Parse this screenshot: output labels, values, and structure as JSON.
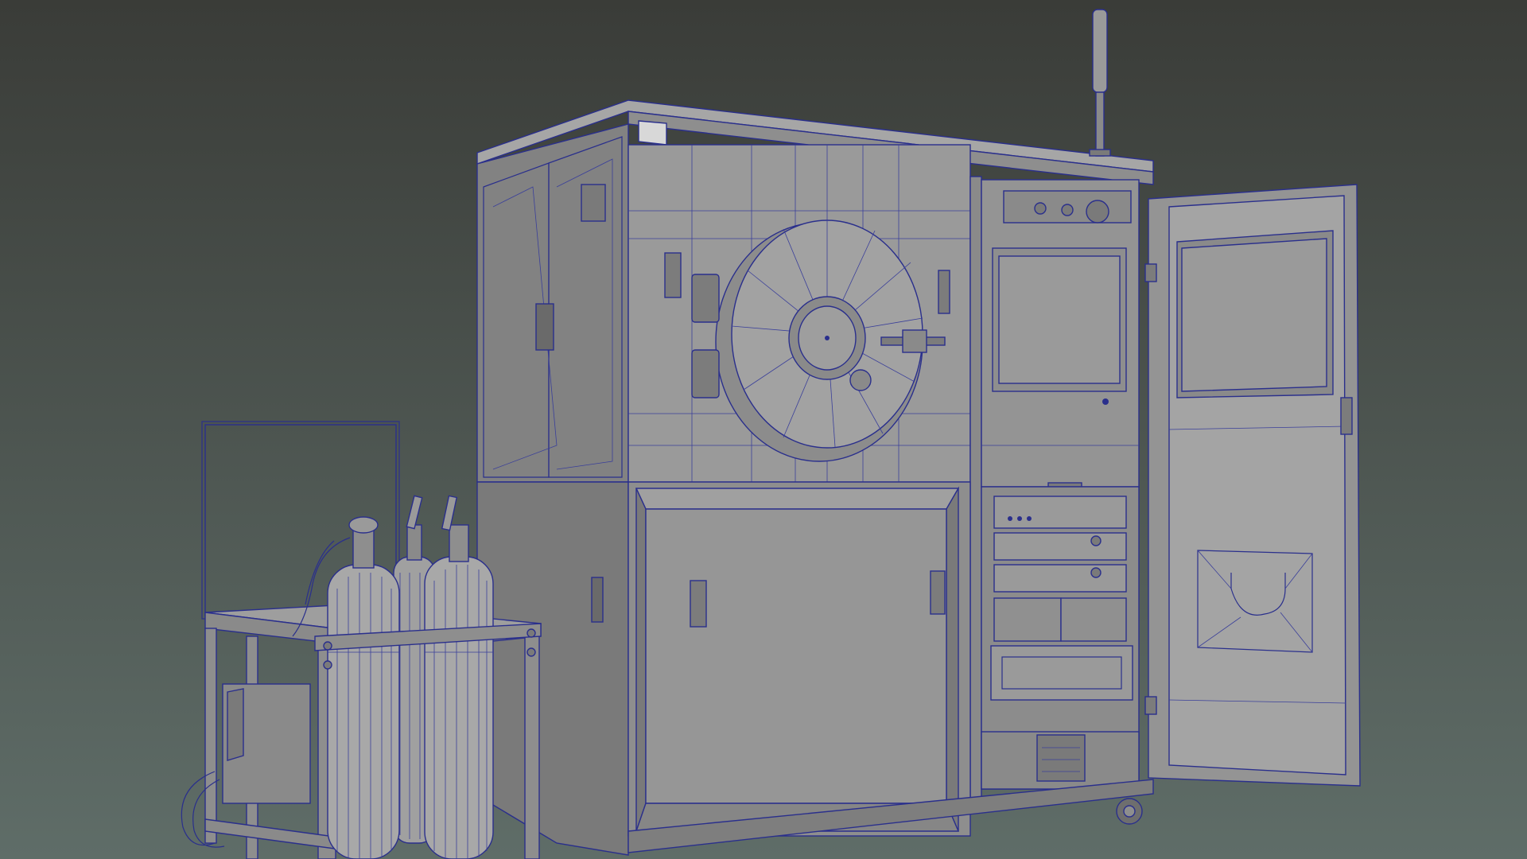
{
  "viewport": {
    "background_top": "#3a3c38",
    "background_bottom": "#5f6d68",
    "wire_color": "#2a2f8c",
    "surface_light": "#9a9a9a",
    "surface_mid": "#8a8a8a",
    "surface_dark": "#6e6e6e"
  },
  "objects": [
    {
      "name": "main-cabinet"
    },
    {
      "name": "chamber-door"
    },
    {
      "name": "open-side-door"
    },
    {
      "name": "gas-cylinder-cart"
    },
    {
      "name": "antenna-mast"
    }
  ]
}
